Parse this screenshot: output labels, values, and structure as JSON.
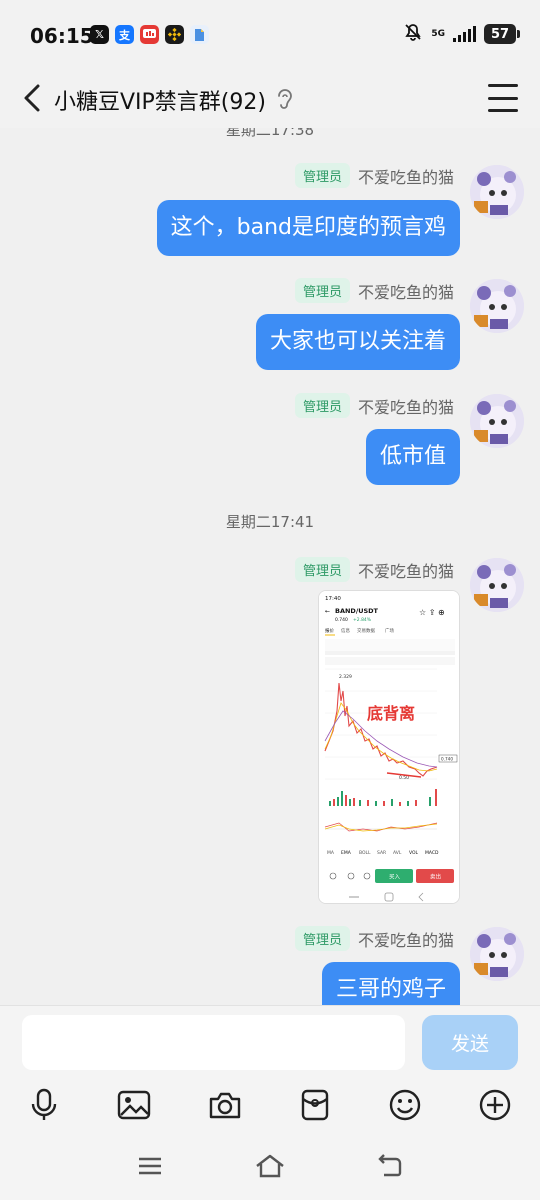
{
  "status": {
    "time": "06:15",
    "network": "5G",
    "battery": "57",
    "app_icons": [
      {
        "name": "x-app-icon",
        "glyph": "𝕏",
        "color": "#111111"
      },
      {
        "name": "alipay-icon",
        "glyph": "支",
        "color": "#1677ff"
      },
      {
        "name": "news-app-icon",
        "glyph": "",
        "color": "#e53935"
      },
      {
        "name": "binance-icon",
        "glyph": "",
        "color": "#1a1a1a"
      },
      {
        "name": "files-app-icon",
        "glyph": "",
        "color": "#4a90e2"
      }
    ]
  },
  "header": {
    "title": "小糖豆VIP禁言群(92)"
  },
  "chat": {
    "timestamp_top_partial": "星期二17:38",
    "timestamp_mid": "星期二17:41",
    "messages": [
      {
        "badge": "管理员",
        "sender": "不爱吃鱼的猫",
        "text": "这个，band是印度的预言鸡"
      },
      {
        "badge": "管理员",
        "sender": "不爱吃鱼的猫",
        "text": "大家也可以关注着"
      },
      {
        "badge": "管理员",
        "sender": "不爱吃鱼的猫",
        "text": "低市值"
      },
      {
        "badge": "管理员",
        "sender": "不爱吃鱼的猫",
        "image": {
          "status_time": "17:40",
          "pair": "BAND/USDT",
          "price": "0.740",
          "change": "+2.84%",
          "tabs": [
            "报价",
            "信息",
            "交易数据",
            "广场"
          ],
          "high_label": "2.329",
          "low_label": "0.50",
          "annotation": "底背离",
          "indicators": [
            "MA",
            "EMA",
            "BOLL",
            "SAR",
            "AVL",
            "VOL",
            "MACD"
          ],
          "buy_label": "买入",
          "sell_label": "卖出"
        }
      },
      {
        "badge": "管理员",
        "sender": "不爱吃鱼的猫",
        "text": "三哥的鸡子"
      }
    ]
  },
  "input": {
    "placeholder": "",
    "send_label": "发送"
  },
  "colors": {
    "bubble": "#3d8df5",
    "badge_bg": "#dff3e9",
    "badge_text": "#2e9a66",
    "send_disabled": "#a9d1f7"
  }
}
